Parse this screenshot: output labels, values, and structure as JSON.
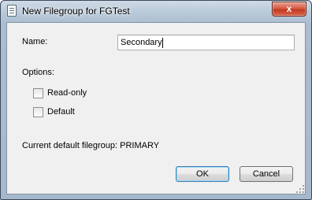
{
  "window": {
    "title": "New Filegroup for FGTest",
    "close_symbol": "x",
    "title_icon": "document-icon"
  },
  "form": {
    "name_label": "Name:",
    "name_value": "Secondary",
    "options_label": "Options:",
    "options": [
      {
        "label": "Read-only",
        "checked": false
      },
      {
        "label": "Default",
        "checked": false
      }
    ],
    "current_default_text": "Current default filegroup: PRIMARY"
  },
  "buttons": {
    "ok_label": "OK",
    "cancel_label": "Cancel"
  },
  "colors": {
    "accent": "#3c7fb1",
    "close_button": "#c23a22",
    "client_background": "#f0f0f0"
  }
}
